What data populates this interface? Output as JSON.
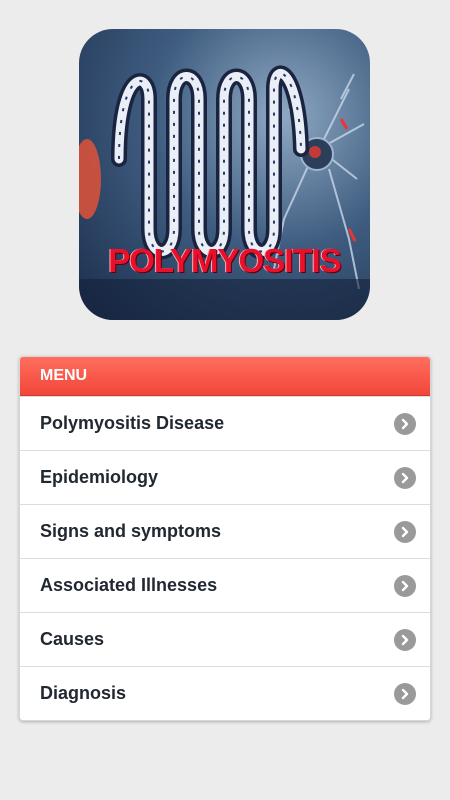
{
  "hero": {
    "title": "POLYMYOSITIS",
    "image": "polymyositis-neuron-illustration"
  },
  "menu": {
    "header": "MENU",
    "items": [
      {
        "label": "Polymyositis Disease",
        "icon": "chevron-right-icon"
      },
      {
        "label": "Epidemiology",
        "icon": "chevron-right-icon"
      },
      {
        "label": "Signs and symptoms",
        "icon": "chevron-right-icon"
      },
      {
        "label": "Associated Illnesses",
        "icon": "chevron-right-icon"
      },
      {
        "label": "Causes",
        "icon": "chevron-right-icon"
      },
      {
        "label": "Diagnosis",
        "icon": "chevron-right-icon"
      }
    ]
  },
  "colors": {
    "background": "#ececec",
    "header": "#f2463a",
    "title_red": "#e8102a",
    "chevron": "#9a9a9a"
  }
}
